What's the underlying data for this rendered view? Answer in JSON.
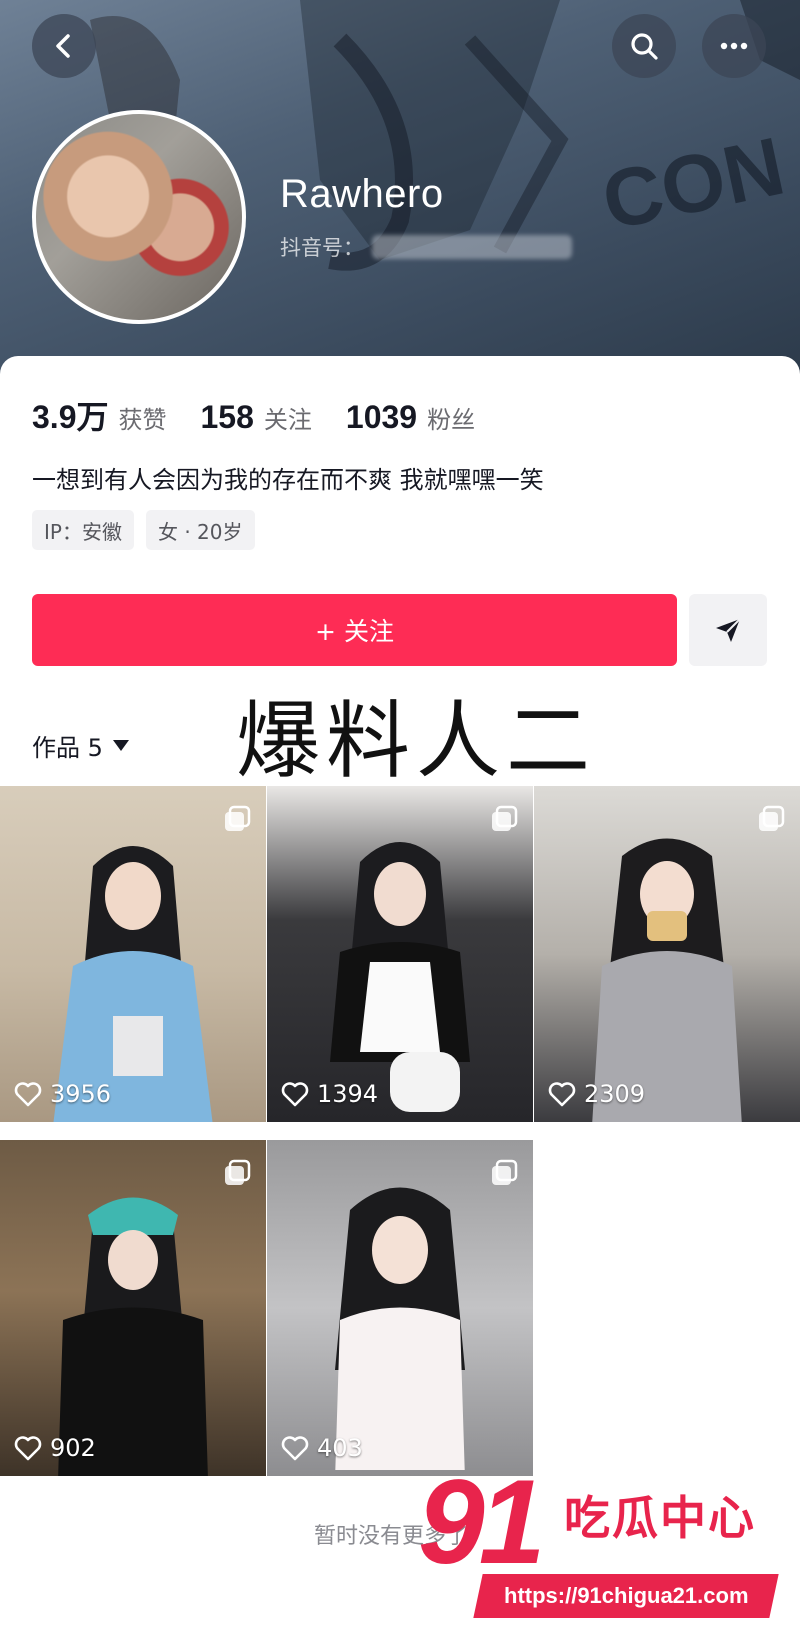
{
  "profile": {
    "username": "Rawhero",
    "id_label": "抖音号：",
    "id_value": ""
  },
  "nav": {
    "back_icon": "chevron-left-icon",
    "search_icon": "search-icon",
    "more_icon": "ellipsis-icon"
  },
  "stats": {
    "likes_value": "3.9万",
    "likes_label": "获赞",
    "following_value": "158",
    "following_label": "关注",
    "followers_value": "1039",
    "followers_label": "粉丝"
  },
  "bio": "一想到有人会因为我的存在而不爽 我就嘿嘿一笑",
  "tags": [
    "IP：安徽",
    "女 · 20岁"
  ],
  "actions": {
    "follow_label": "+ 关注",
    "send_icon": "send-icon"
  },
  "works": {
    "label": "作品 5",
    "overlay_title": "爆料人二",
    "items": [
      {
        "likes": "3956",
        "multi": true
      },
      {
        "likes": "1394",
        "multi": true
      },
      {
        "likes": "2309",
        "multi": true
      },
      {
        "likes": "902",
        "multi": true
      },
      {
        "likes": "403",
        "multi": true
      }
    ],
    "end_text": "暂时没有更多了"
  },
  "watermark": {
    "number": "91",
    "name": "吃瓜中心",
    "url": "https://91chigua21.com"
  },
  "colors": {
    "accent": "#fe2c55",
    "watermark": "#e8244c",
    "banner": "#4f6176"
  }
}
